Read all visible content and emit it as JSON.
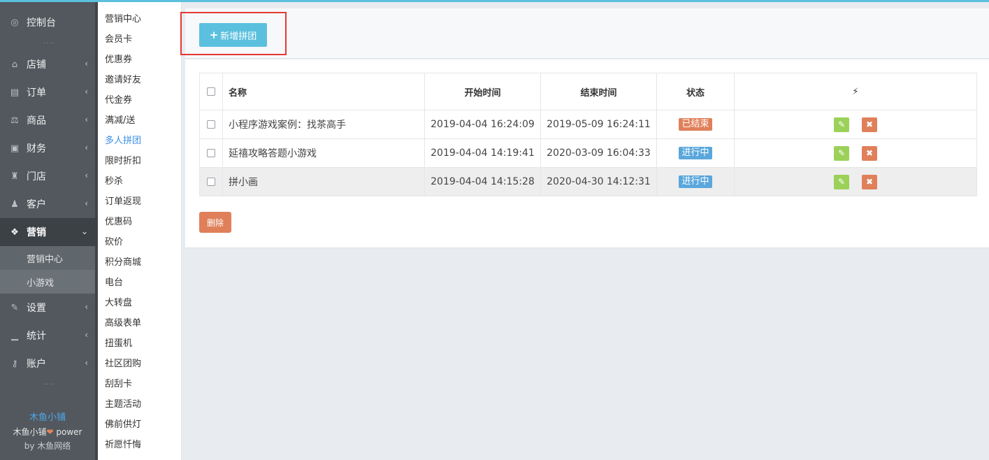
{
  "sidebar": {
    "items": [
      {
        "label": "控制台",
        "icon": "dashboard-icon",
        "glyph": "◎",
        "chevron": ""
      },
      {
        "label": "店铺",
        "icon": "basket-icon",
        "glyph": "⌂",
        "chevron": "‹"
      },
      {
        "label": "订单",
        "icon": "money-icon",
        "glyph": "▤",
        "chevron": "‹"
      },
      {
        "label": "商品",
        "icon": "scale-icon",
        "glyph": "⚖",
        "chevron": "‹"
      },
      {
        "label": "财务",
        "icon": "bill-icon",
        "glyph": "▣",
        "chevron": "‹"
      },
      {
        "label": "门店",
        "icon": "sitemap-icon",
        "glyph": "♜",
        "chevron": "‹"
      },
      {
        "label": "客户",
        "icon": "users-icon",
        "glyph": "♟",
        "chevron": "‹"
      },
      {
        "label": "营销",
        "icon": "gift-icon",
        "glyph": "❖",
        "chevron": "⌄"
      },
      {
        "label": "设置",
        "icon": "wrench-icon",
        "glyph": "✎",
        "chevron": "‹"
      },
      {
        "label": "统计",
        "icon": "signal-icon",
        "glyph": "▁",
        "chevron": "‹"
      },
      {
        "label": "账户",
        "icon": "key-icon",
        "glyph": "⚷",
        "chevron": "‹"
      }
    ],
    "dots": "····",
    "submenu": [
      "营销中心",
      "小游戏"
    ],
    "footer": {
      "brand": "木鱼小铺",
      "power_prefix": "木鱼小铺",
      "heart": "❤",
      "power_suffix": " power",
      "by": "by 木鱼网络"
    }
  },
  "subcolumn": {
    "items": [
      "营销中心",
      "会员卡",
      "优惠券",
      "邀请好友",
      "代金券",
      "满减/送",
      "多人拼团",
      "限时折扣",
      "秒杀",
      "订单返现",
      "优惠码",
      "砍价",
      "积分商城",
      "电台",
      "大转盘",
      "高级表单",
      "扭蛋机",
      "社区团购",
      "刮刮卡",
      "主题活动",
      "佛前供灯",
      "祈愿忏悔"
    ],
    "current": "多人拼团"
  },
  "toolbar": {
    "add_label": "新增拼团",
    "add_icon": "+"
  },
  "table": {
    "headers": {
      "name": "名称",
      "start": "开始时间",
      "end": "结束时间",
      "state": "状态",
      "ops": "⚡"
    },
    "rows": [
      {
        "name": "小程序游戏案例：找茶高手",
        "start": "2019-04-04 16:24:09",
        "end": "2019-05-09 16:24:11",
        "state": "已结束",
        "state_kind": "ended"
      },
      {
        "name": "延禧攻略答题小游戏",
        "start": "2019-04-04 14:19:41",
        "end": "2020-03-09 16:04:33",
        "state": "进行中",
        "state_kind": "running"
      },
      {
        "name": "拼小画",
        "start": "2019-04-04 14:15:28",
        "end": "2020-04-30 14:12:31",
        "state": "进行中",
        "state_kind": "running"
      }
    ]
  },
  "actions": {
    "delete_label": "删除",
    "edit_glyph": "✎",
    "remove_glyph": "✖"
  },
  "colors": {
    "accent": "#5bc0de",
    "ended": "#e0805a",
    "running": "#5aa7dc",
    "edit": "#9cd159",
    "highlight": "#e53935"
  }
}
